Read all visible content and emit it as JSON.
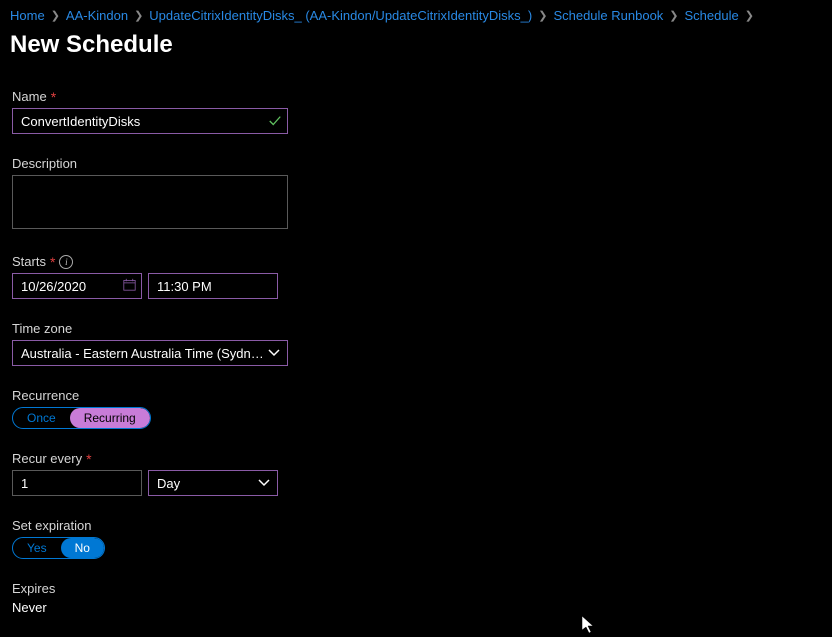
{
  "breadcrumb": {
    "items": [
      {
        "label": "Home"
      },
      {
        "label": "AA-Kindon"
      },
      {
        "label": "UpdateCitrixIdentityDisks_ (AA-Kindon/UpdateCitrixIdentityDisks_)"
      },
      {
        "label": "Schedule Runbook"
      },
      {
        "label": "Schedule"
      }
    ]
  },
  "page_title": "New Schedule",
  "form": {
    "name": {
      "label": "Name",
      "value": "ConvertIdentityDisks"
    },
    "description": {
      "label": "Description",
      "value": ""
    },
    "starts": {
      "label": "Starts",
      "date": "10/26/2020",
      "time": "11:30 PM"
    },
    "timezone": {
      "label": "Time zone",
      "value": "Australia - Eastern Australia Time (Sydn…"
    },
    "recurrence": {
      "label": "Recurrence",
      "options": {
        "once": "Once",
        "recurring": "Recurring"
      }
    },
    "recur_every": {
      "label": "Recur every",
      "count": "1",
      "unit": "Day"
    },
    "set_expiration": {
      "label": "Set expiration",
      "options": {
        "yes": "Yes",
        "no": "No"
      }
    },
    "expires": {
      "label": "Expires",
      "value": "Never"
    }
  }
}
